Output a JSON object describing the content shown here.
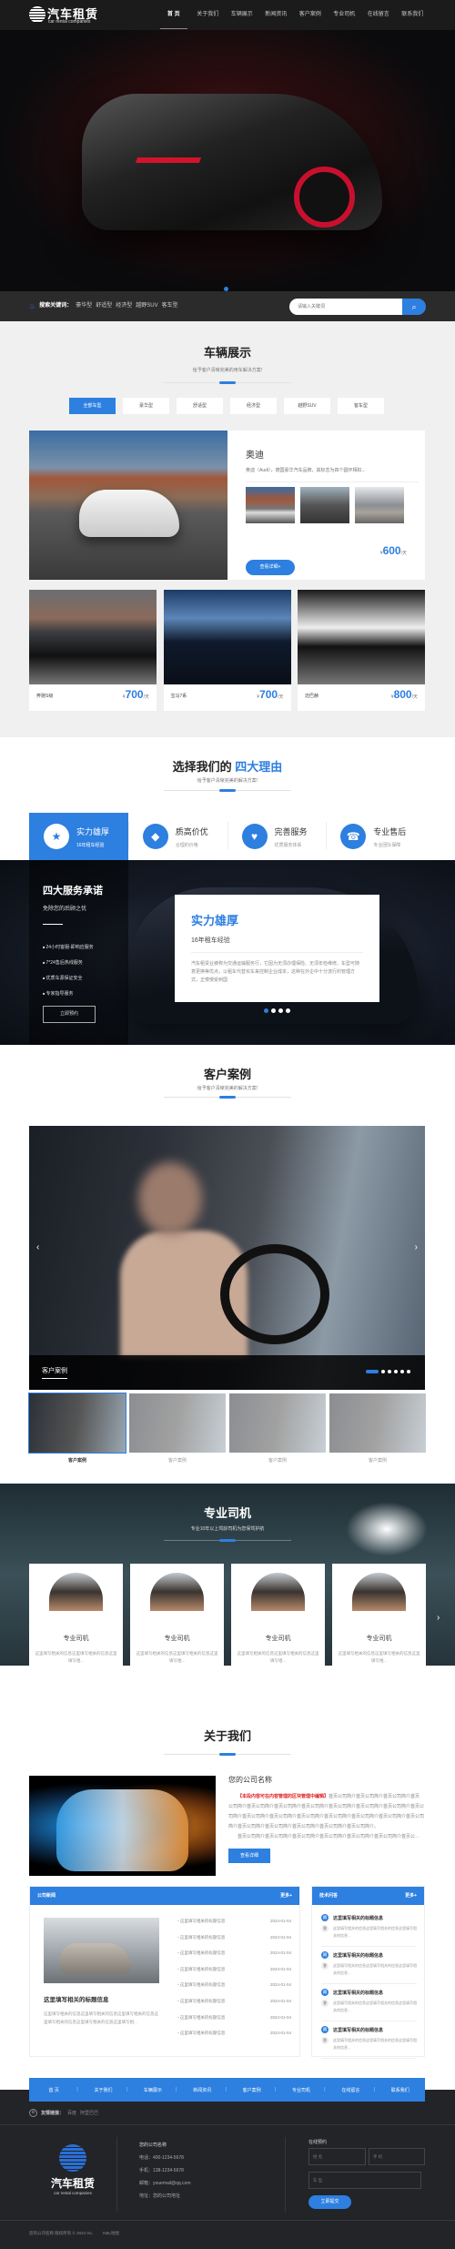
{
  "colors": {
    "accent": "#2d7fe0",
    "header_bg": "#1b1b1b",
    "footer_bg": "#222427",
    "highlight_red": "#e01e1e"
  },
  "header": {
    "logo_title": "汽车租赁",
    "logo_subtitle": "car rental companies",
    "nav": [
      {
        "label": "首 页",
        "active": true
      },
      {
        "label": "关于我们"
      },
      {
        "label": "车辆展示"
      },
      {
        "label": "新闻资讯"
      },
      {
        "label": "客户案例"
      },
      {
        "label": "专业司机"
      },
      {
        "label": "在线留言"
      },
      {
        "label": "联系我们"
      }
    ]
  },
  "hero": {
    "slide_count": 1,
    "active_slide": 1
  },
  "search": {
    "icon": "flame-icon",
    "label": "搜索关键词：",
    "keywords": [
      "豪华型",
      "舒适型",
      "经济型",
      "越野SUV",
      "客车型"
    ],
    "placeholder": "请输入关键词",
    "button_icon": "search-icon"
  },
  "vehicles": {
    "title": "车辆展示",
    "subtitle": "给予客户清晰完美的用车解决方案!",
    "tabs": [
      {
        "label": "全部车型",
        "active": true
      },
      {
        "label": "豪华型"
      },
      {
        "label": "舒适型"
      },
      {
        "label": "经济型"
      },
      {
        "label": "越野SUV"
      },
      {
        "label": "客车型"
      }
    ],
    "featured": {
      "name": "奥迪",
      "desc": "奥迪（Audi），德国豪华汽车品牌，其标志为四个圆环相扣...",
      "button": "查看详细+",
      "currency": "¥",
      "price": "600",
      "unit": "/天"
    },
    "cards": [
      {
        "name": "奔驰S级",
        "currency": "¥",
        "price": "700",
        "unit": "/天"
      },
      {
        "name": "宝马7系",
        "currency": "¥",
        "price": "700",
        "unit": "/天"
      },
      {
        "name": "迈巴赫",
        "currency": "¥",
        "price": "800",
        "unit": "/天"
      }
    ]
  },
  "reasons": {
    "title_prefix": "选择我们的 ",
    "title_highlight": "四大理由",
    "subtitle": "给予客户清晰完美的解决方案!",
    "items": [
      {
        "icon": "bookmark-star-icon",
        "glyph": "★",
        "title": "实力雄厚",
        "desc": "16年租车经验",
        "active": true
      },
      {
        "icon": "cube-icon",
        "glyph": "◆",
        "title": "质高价优",
        "desc": "合理的价格"
      },
      {
        "icon": "heart-icon",
        "glyph": "♥",
        "title": "完善服务",
        "desc": "优质服务体系"
      },
      {
        "icon": "headset-icon",
        "glyph": "☎",
        "title": "专业售后",
        "desc": "专业团队保障"
      }
    ]
  },
  "promise": {
    "title": "四大服务承诺",
    "subtitle": "免除您的后顾之忧",
    "items": [
      "24小时客服-即响应服务",
      "7*24售后热线服务",
      "优质车源保证安全",
      "专家指导服务"
    ],
    "button": "立即预约",
    "card": {
      "title": "实力雄厚",
      "subtitle": "16年租车经验",
      "text": "汽车租赁业被称为交通运输服务行，它因为无须办理保险、无须年检维修、车型可随意更换等优点，以租车代替买车来控制企业成本，这种在外企中十分流行的管理方式，正慢慢受到国"
    },
    "dots": 4,
    "active_dot": 1
  },
  "cases": {
    "title": "客户案例",
    "subtitle": "给予客户清晰完美的解决方案!",
    "caption": "客户案例",
    "dots": 6,
    "active_dot": 1,
    "thumbs": [
      {
        "label": "客户案例",
        "active": true
      },
      {
        "label": "客户案例"
      },
      {
        "label": "客户案例"
      },
      {
        "label": "客户案例"
      }
    ]
  },
  "drivers": {
    "title": "专业司机",
    "subtitle": "专业10年以上驾龄司机为您保驾护航",
    "cards": [
      {
        "name": "专业司机",
        "desc": "这里填写相关的信息这里填写相关的信息这里填写相..."
      },
      {
        "name": "专业司机",
        "desc": "这里填写相关的信息这里填写相关的信息这里填写相..."
      },
      {
        "name": "专业司机",
        "desc": "这里填写相关的信息这里填写相关的信息这里填写相..."
      },
      {
        "name": "专业司机",
        "desc": "这里填写相关的信息这里填写相关的信息这里填写相..."
      }
    ]
  },
  "about": {
    "title": "关于我们",
    "company": "您的公司名称",
    "note": "【本段内容可在内容管理的区块管理中编辑】",
    "text": "首页公司简介首页公司简介首页公司简介首页公司简介首页公司简介首页公司简介首页公司简介首页公司简介首页公司简介首页公司简介首页公司简介首页公司简介首页公司简介首页公司简介首页公司简介首页公司简介首页公司简介首页公司简介首页公司简介首页公司简介首页公司简介首页公司简介首页公司简介。",
    "text2": "首页公司简介首页公司简介首页公司简介首页公司简介首页公司简介首页公司简介首页公司简介...",
    "button": "查看详细"
  },
  "news": {
    "title": "公司新闻",
    "more": "更多+",
    "featured_title": "这里填写相关的标题信息",
    "featured_desc": "这里填写相关的信息这里填写相关的信息这里填写相关的信息这里填写相关的信息这里填写相关的信息这里填写相...",
    "items": [
      {
        "title": "这里填写相关的标题信息",
        "date": "2024-01-04"
      },
      {
        "title": "这里填写相关的标题信息",
        "date": "2024-01-04"
      },
      {
        "title": "这里填写相关的标题信息",
        "date": "2024-01-04"
      },
      {
        "title": "这里填写相关的标题信息",
        "date": "2024-01-04"
      },
      {
        "title": "这里填写相关的标题信息",
        "date": "2024-01-04"
      },
      {
        "title": "这里填写相关的标题信息",
        "date": "2024-01-04"
      },
      {
        "title": "这里填写相关的标题信息",
        "date": "2024-01-04"
      },
      {
        "title": "这里填写相关的标题信息",
        "date": "2024-01-04"
      }
    ]
  },
  "qa": {
    "title": "技术问答",
    "more": "更多+",
    "q_mark": "问",
    "a_mark": "答",
    "items": [
      {
        "q": "这里填写相关的标题信息",
        "a": "这里填写相关的信息这里填写相关的信息这里填写相关的信息..."
      },
      {
        "q": "这里填写相关的标题信息",
        "a": "这里填写相关的信息这里填写相关的信息这里填写相关的信息..."
      },
      {
        "q": "这里填写相关的标题信息",
        "a": "这里填写相关的信息这里填写相关的信息这里填写相关的信息..."
      },
      {
        "q": "这里填写相关的标题信息",
        "a": "这里填写相关的信息这里填写相关的信息这里填写相关的信息..."
      }
    ]
  },
  "footer": {
    "nav": [
      "首 页",
      "关于我们",
      "车辆展示",
      "新闻资讯",
      "客户案例",
      "专业司机",
      "在线留言",
      "联系我们"
    ],
    "links_label": "友情链接：",
    "links": [
      "百度",
      "阿里巴巴"
    ],
    "logo_title": "汽车租赁",
    "logo_subtitle": "car rental companies",
    "contact": {
      "company": "您的公司名称",
      "phone": "电话：400-1234-5678",
      "mobile": "手机：138-1234-5678",
      "email": "邮箱：youemail@qq.com",
      "address": "地址：您的公司地址"
    },
    "form": {
      "title": "在线预约",
      "name_placeholder": "姓 名",
      "phone_placeholder": "手 机",
      "car_placeholder": "车 型",
      "submit": "立即提交"
    },
    "copyright": "您的公司名称   版权所有 © 2024 Inc.",
    "sitemap": "XML地图"
  }
}
